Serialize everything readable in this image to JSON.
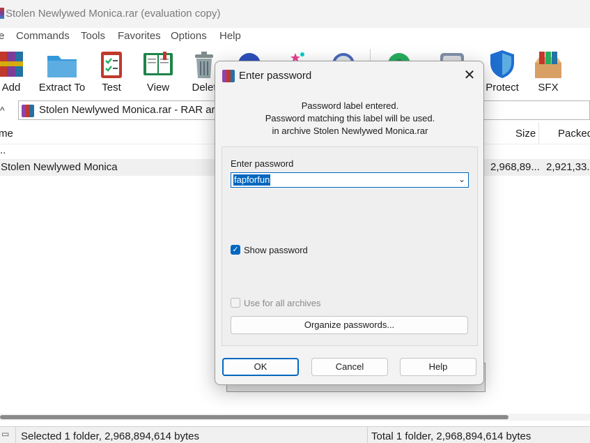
{
  "window": {
    "title": "Stolen Newlywed Monica.rar (evaluation copy)"
  },
  "menu": [
    "e",
    "Commands",
    "Tools",
    "Favorites",
    "Options",
    "Help"
  ],
  "toolbar": [
    {
      "label": "Add",
      "icon": "add-archive-icon"
    },
    {
      "label": "Extract To",
      "icon": "extract-folder-icon"
    },
    {
      "label": "Test",
      "icon": "test-clipboard-icon"
    },
    {
      "label": "View",
      "icon": "view-book-icon"
    },
    {
      "label": "Delet",
      "icon": "delete-trash-icon"
    },
    {
      "label": "",
      "icon": "find-icon"
    },
    {
      "label": "",
      "icon": "wizard-icon"
    },
    {
      "label": "",
      "icon": "info-icon"
    },
    {
      "label": "",
      "icon": "virus-scan-icon"
    },
    {
      "label": "",
      "icon": "comment-icon"
    },
    {
      "label": "Protect",
      "icon": "shield-icon"
    },
    {
      "label": "SFX",
      "icon": "sfx-box-icon"
    }
  ],
  "address": {
    "up": "^",
    "path": "Stolen Newlywed Monica.rar - RAR arc"
  },
  "columns": {
    "name": "me",
    "size": "Size",
    "packed": "Packed"
  },
  "rows": [
    {
      "name": ".."
    },
    {
      "name": "Stolen Newlywed Monica",
      "size": "2,968,89...",
      "packed": "2,921,33..."
    }
  ],
  "status": {
    "left": "Selected 1 folder, 2,968,894,614 bytes",
    "right": "Total 1 folder, 2,968,894,614 bytes"
  },
  "dialog": {
    "title": "Enter password",
    "close": "✕",
    "info_line1": "Password label entered.",
    "info_line2": "Password matching this label will be used.",
    "info_line3": "in archive Stolen Newlywed Monica.rar",
    "password_label": "Enter password",
    "password_value": "fapforfun",
    "show_password_label": "Show password",
    "show_password_checked": true,
    "use_all_label": "Use for all archives",
    "use_all_checked": false,
    "organize_label": "Organize passwords...",
    "ok_label": "OK",
    "cancel_label": "Cancel",
    "help_label": "Help"
  },
  "colors": {
    "accent": "#0067c0",
    "titlebar": "#f3f3f3",
    "dialog_bg": "#f3f3f3"
  }
}
